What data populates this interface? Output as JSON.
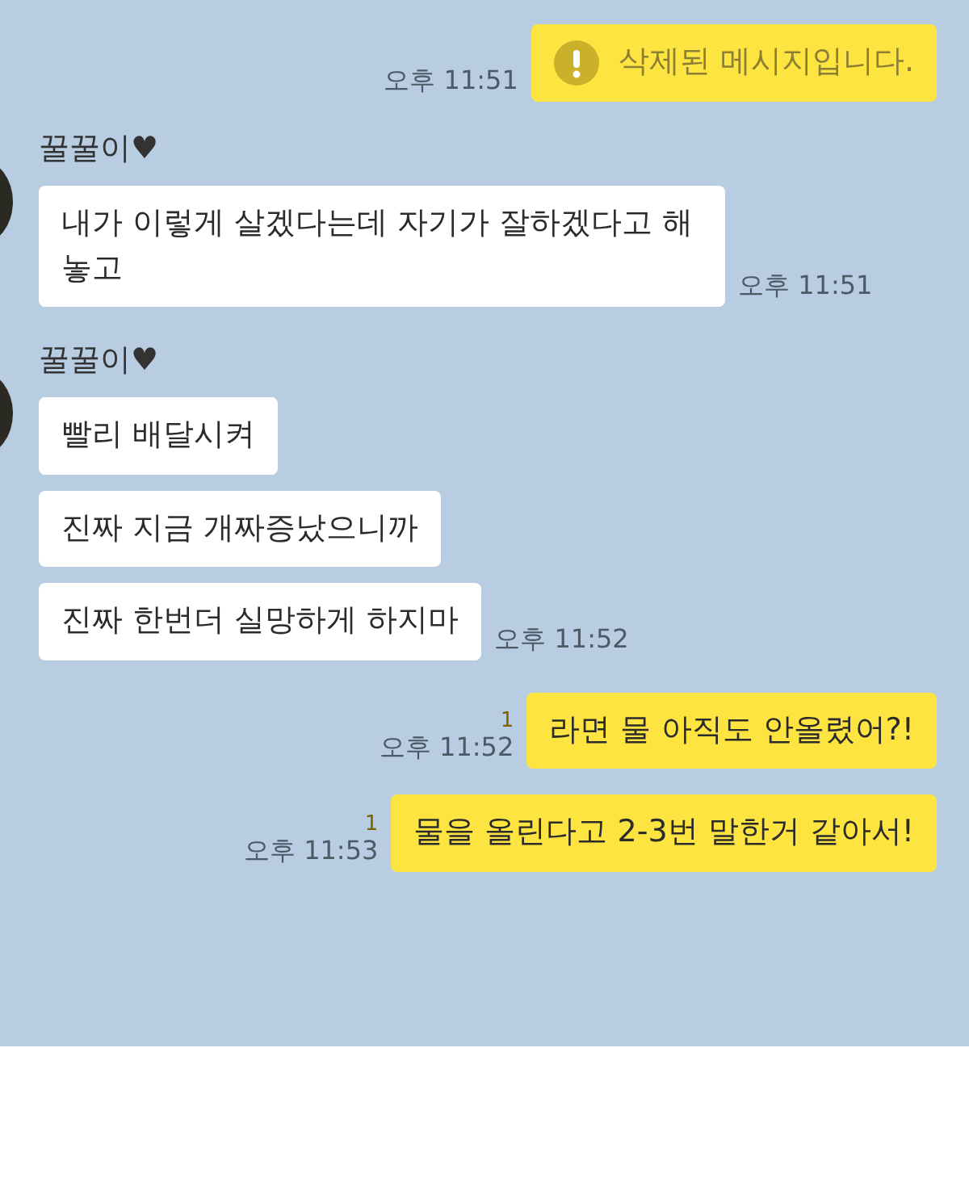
{
  "messages": [
    {
      "kind": "sent",
      "deleted": true,
      "text": "삭제된 메시지입니다.",
      "time": "오후 11:51"
    },
    {
      "kind": "received",
      "sender": "꿀꿀이♥",
      "bubbles": [
        {
          "text": "내가 이렇게 살겠다는데 자기가 잘하겠다고 해놓고",
          "time": "오후 11:51"
        }
      ]
    },
    {
      "kind": "received",
      "sender": "꿀꿀이♥",
      "bubbles": [
        {
          "text": "빨리 배달시켜"
        },
        {
          "text": "진짜 지금 개짜증났으니까"
        },
        {
          "text": "진짜 한번더 실망하게 하지마",
          "time": "오후 11:52"
        }
      ]
    },
    {
      "kind": "sent",
      "deleted": false,
      "unread": "1",
      "text": "라면 물 아직도 안올렸어?!",
      "time": "오후 11:52"
    },
    {
      "kind": "sent",
      "deleted": false,
      "unread": "1",
      "text": "물을 올린다고 2-3번 말한거 같아서!",
      "time": "오후 11:53"
    }
  ]
}
